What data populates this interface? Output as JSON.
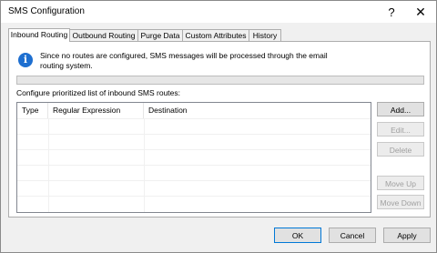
{
  "window": {
    "title": "SMS Configuration",
    "help": "?",
    "close": "✕"
  },
  "tabs": [
    {
      "label": "Inbound Routing"
    },
    {
      "label": "Outbound Routing"
    },
    {
      "label": "Purge Data"
    },
    {
      "label": "Custom Attributes"
    },
    {
      "label": "History"
    }
  ],
  "info": {
    "icon": "info-icon",
    "text": "Since no routes are configured, SMS messages will be processed through the email routing system."
  },
  "progress": {
    "value_percent": 0
  },
  "routes": {
    "label": "Configure prioritized list of inbound SMS routes:",
    "columns": [
      "Type",
      "Regular Expression",
      "Destination"
    ]
  },
  "side_buttons": {
    "add": "Add...",
    "edit": "Edit...",
    "delete": "Delete",
    "move_up": "Move Up",
    "move_down": "Move Down"
  },
  "footer": {
    "ok": "OK",
    "cancel": "Cancel",
    "apply": "Apply"
  },
  "colors": {
    "accent": "#0078d7",
    "info_icon": "#1e6fd0"
  }
}
